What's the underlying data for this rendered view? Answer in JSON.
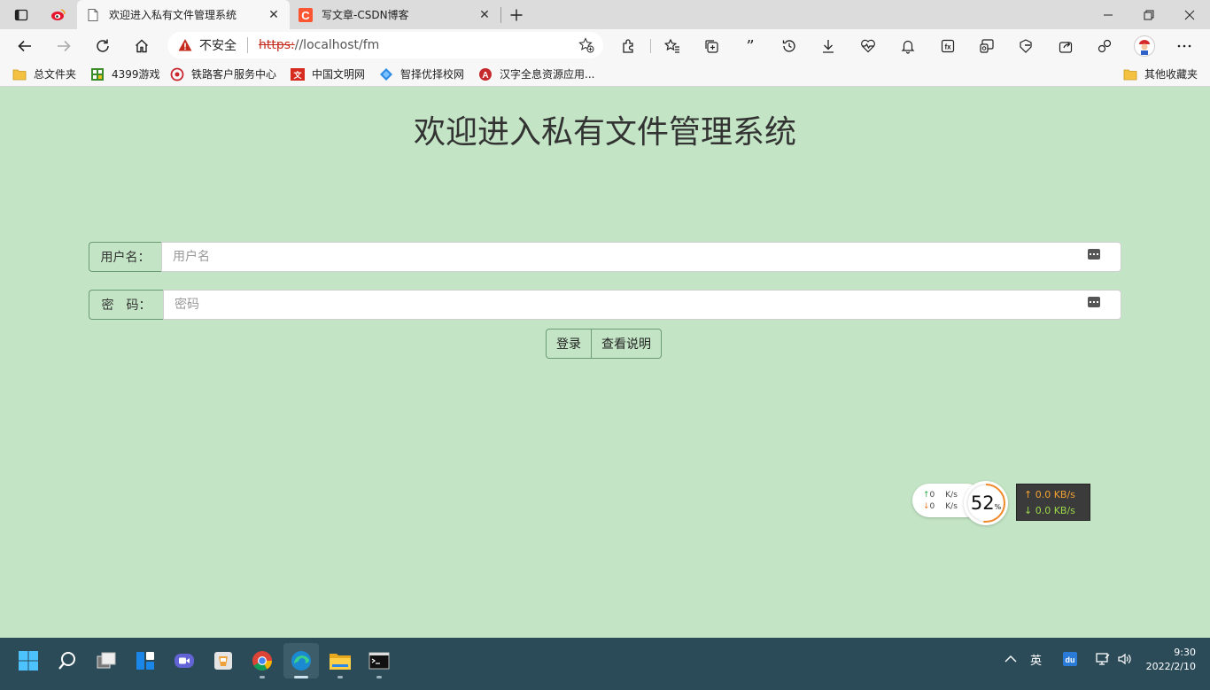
{
  "browser": {
    "tabs": [
      {
        "label": "欢迎进入私有文件管理系统",
        "active": true
      },
      {
        "label": "写文章-CSDN博客",
        "active": false
      }
    ],
    "address": {
      "security_label": "不安全",
      "url_scheme": "https:",
      "url_rest": "//localhost/fm"
    },
    "bookmarks": [
      {
        "label": "总文件夹",
        "icon": "folder-icon"
      },
      {
        "label": "4399游戏",
        "icon": "game-icon"
      },
      {
        "label": "铁路客户服务中心",
        "icon": "railway-icon"
      },
      {
        "label": "中国文明网",
        "icon": "civilization-icon"
      },
      {
        "label": "智择优择校网",
        "icon": "school-icon"
      },
      {
        "label": "汉字全息资源应用...",
        "icon": "hanzi-icon"
      }
    ],
    "other_bookmarks": "其他收藏夹"
  },
  "page": {
    "title": "欢迎进入私有文件管理系统",
    "username": {
      "label": "用户名：",
      "placeholder": "用户名",
      "value": ""
    },
    "password": {
      "label": "密　码：",
      "placeholder": "密码",
      "value": ""
    },
    "login_button": "登录",
    "help_button": "查看说明"
  },
  "widgets": {
    "speed_up": "0",
    "speed_down": "0",
    "speed_unit": "K/s",
    "percent": "52",
    "percent_unit": "%",
    "meter_up": "↑ 0.0 KB/s",
    "meter_down": "↓ 0.0 KB/s"
  },
  "taskbar": {
    "ime": "英",
    "time": "9:30",
    "date": "2022/2/10"
  },
  "colors": {
    "page_bg": "#c3e5c5",
    "taskbar_bg": "#2c4b58",
    "insecure_red": "#c42b1c"
  }
}
